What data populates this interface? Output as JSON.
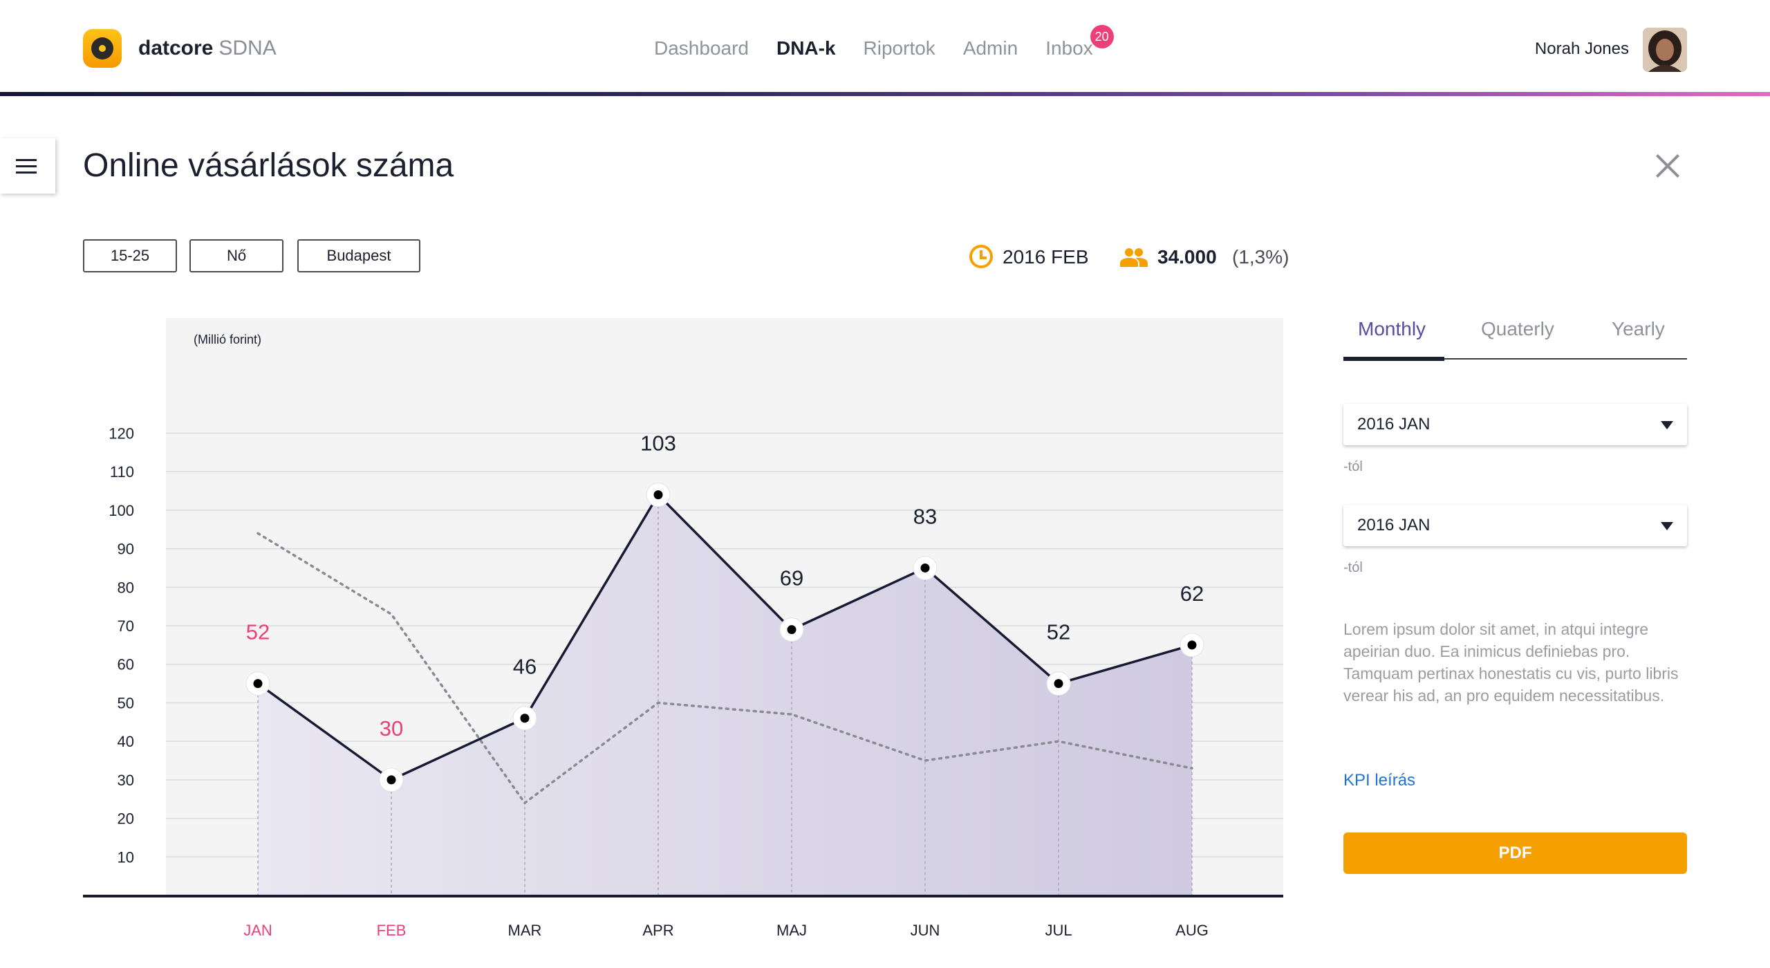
{
  "brand": {
    "name": "datcore",
    "product": "SDNA"
  },
  "nav": {
    "items": [
      {
        "label": "Dashboard",
        "active": false
      },
      {
        "label": "DNA-k",
        "active": true
      },
      {
        "label": "Riportok",
        "active": false
      },
      {
        "label": "Admin",
        "active": false
      },
      {
        "label": "Inbox",
        "active": false,
        "badge": "20"
      }
    ]
  },
  "user": {
    "name": "Norah Jones"
  },
  "page": {
    "title": "Online vásárlások száma"
  },
  "filters": [
    "15-25",
    "Nő",
    "Budapest"
  ],
  "stats": {
    "date": "2016 FEB",
    "count": "34.000",
    "percent": "(1,3%)"
  },
  "tabs": [
    {
      "label": "Monthly",
      "active": true
    },
    {
      "label": "Quaterly",
      "active": false
    },
    {
      "label": "Yearly",
      "active": false
    }
  ],
  "range": {
    "from": {
      "value": "2016 JAN",
      "suffix": "-tól"
    },
    "to": {
      "value": "2016 JAN",
      "suffix": "-tól"
    }
  },
  "description": "Lorem ipsum dolor sit amet, in atqui integre apeirian duo. Ea inimicus definiebas pro. Tamquam pertinax honestatis cu vis, purto libris verear his ad, an pro equidem necessitatibus.",
  "links": {
    "kpi": "KPI leírás"
  },
  "buttons": {
    "pdf": "PDF"
  },
  "colors": {
    "accent": "#f5a000",
    "highlight": "#ec3f77",
    "tab_active": "#5a4aa2",
    "badge": "#ec3f77",
    "link": "#1f74d4"
  },
  "chart_data": {
    "type": "line",
    "unit_label": "(Millió forint)",
    "categories": [
      "JAN",
      "FEB",
      "MAR",
      "APR",
      "MAJ",
      "JUN",
      "JUL",
      "AUG"
    ],
    "highlighted_categories": [
      "JAN",
      "FEB"
    ],
    "yticks": [
      10,
      20,
      30,
      40,
      50,
      60,
      70,
      80,
      90,
      100,
      110,
      120
    ],
    "ylim": [
      0,
      120
    ],
    "grid": true,
    "series": [
      {
        "style": "solid-area",
        "values": [
          55,
          30,
          46,
          104,
          69,
          85,
          55,
          65
        ],
        "labels": [
          "52",
          "30",
          "46",
          "103",
          "69",
          "83",
          "52",
          "62"
        ]
      },
      {
        "style": "dotted",
        "values": [
          94,
          73,
          24,
          50,
          47,
          35,
          40,
          33
        ]
      }
    ]
  }
}
